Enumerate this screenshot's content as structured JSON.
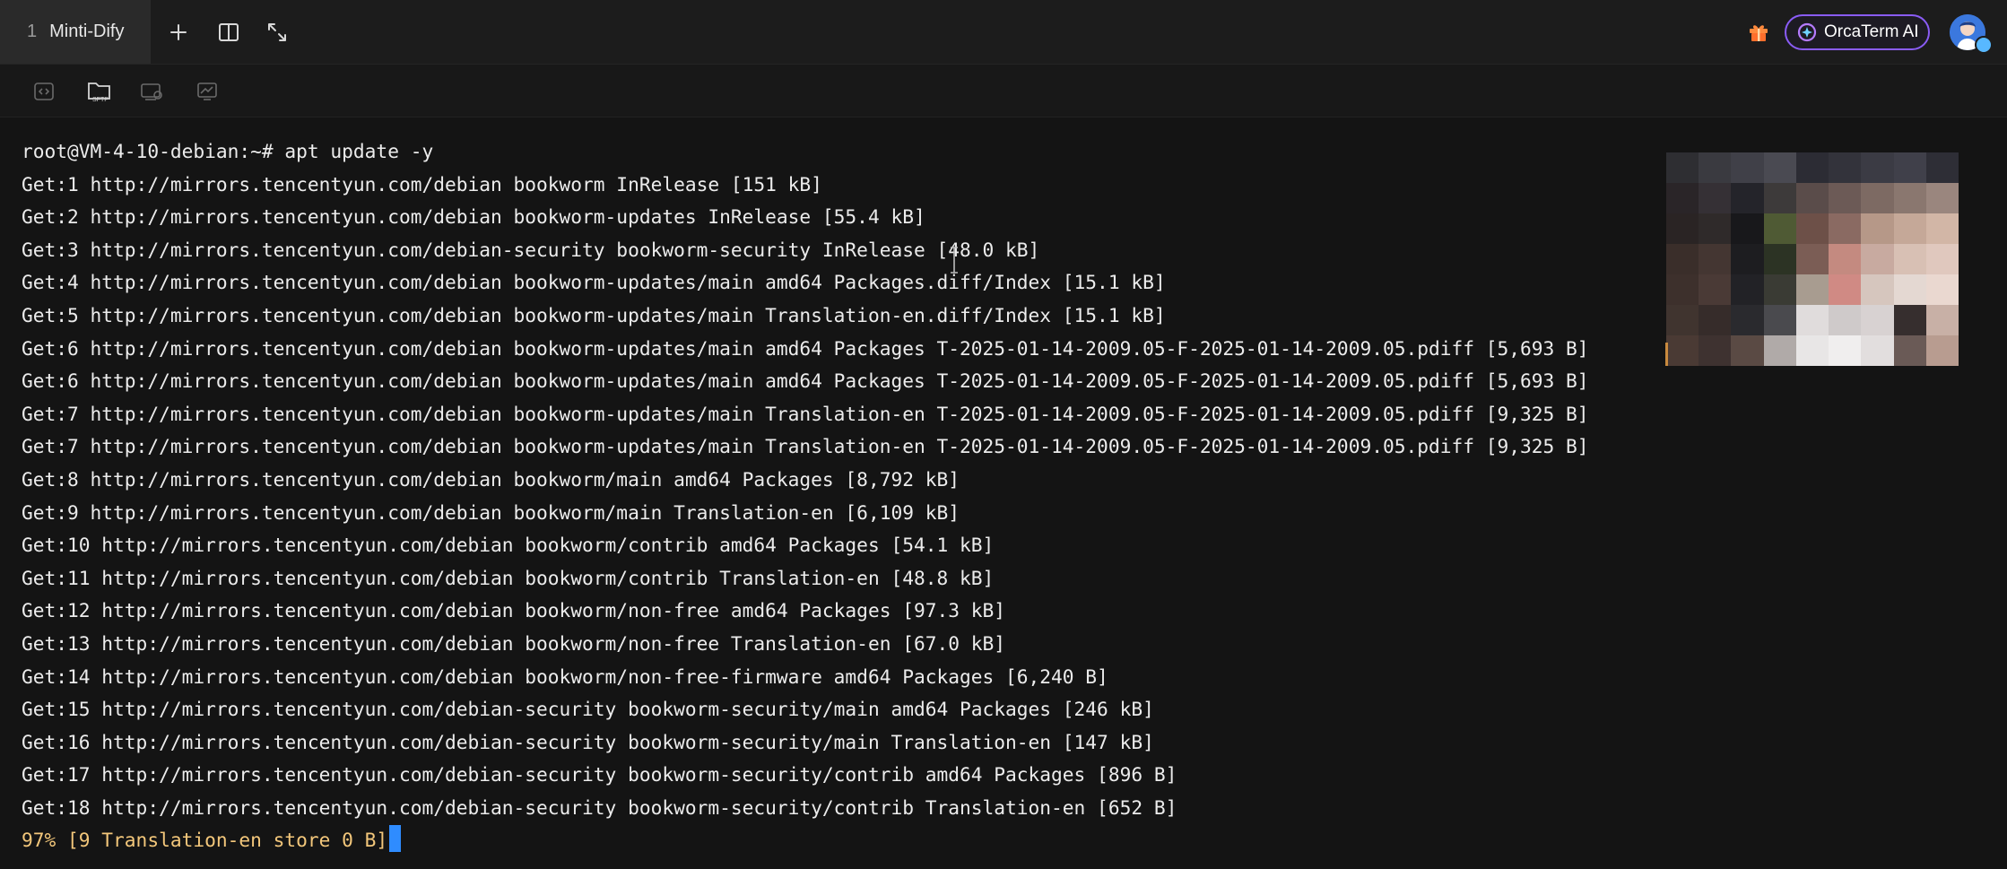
{
  "tab": {
    "index": "1",
    "title": "Minti-Dify"
  },
  "header": {
    "ai_button_label": "OrcaTerm AI",
    "icons": [
      "plus-icon",
      "split-view-icon",
      "expand-icon",
      "gift-icon",
      "orcaterm-logo-icon",
      "avatar"
    ]
  },
  "toolbar": {
    "sftp_label": "SFTP",
    "icons": [
      "code-icon",
      "sftp-folder-icon",
      "screen-record-icon",
      "monitor-chart-icon"
    ]
  },
  "colors": {
    "background": "#141414",
    "text": "#ececec",
    "progress_text": "#f3c77b",
    "cursor": "#2f8cff",
    "ai_border": "#8a5cf6"
  },
  "terminal": {
    "prompt": "root@VM-4-10-debian:~# apt update -y",
    "lines": [
      "Get:1 http://mirrors.tencentyun.com/debian bookworm InRelease [151 kB]",
      "Get:2 http://mirrors.tencentyun.com/debian bookworm-updates InRelease [55.4 kB]",
      "Get:3 http://mirrors.tencentyun.com/debian-security bookworm-security InRelease [48.0 kB]",
      "Get:4 http://mirrors.tencentyun.com/debian bookworm-updates/main amd64 Packages.diff/Index [15.1 kB]",
      "Get:5 http://mirrors.tencentyun.com/debian bookworm-updates/main Translation-en.diff/Index [15.1 kB]",
      "Get:6 http://mirrors.tencentyun.com/debian bookworm-updates/main amd64 Packages T-2025-01-14-2009.05-F-2025-01-14-2009.05.pdiff [5,693 B]",
      "Get:6 http://mirrors.tencentyun.com/debian bookworm-updates/main amd64 Packages T-2025-01-14-2009.05-F-2025-01-14-2009.05.pdiff [5,693 B]",
      "Get:7 http://mirrors.tencentyun.com/debian bookworm-updates/main Translation-en T-2025-01-14-2009.05-F-2025-01-14-2009.05.pdiff [9,325 B]",
      "Get:7 http://mirrors.tencentyun.com/debian bookworm-updates/main Translation-en T-2025-01-14-2009.05-F-2025-01-14-2009.05.pdiff [9,325 B]",
      "Get:8 http://mirrors.tencentyun.com/debian bookworm/main amd64 Packages [8,792 kB]",
      "Get:9 http://mirrors.tencentyun.com/debian bookworm/main Translation-en [6,109 kB]",
      "Get:10 http://mirrors.tencentyun.com/debian bookworm/contrib amd64 Packages [54.1 kB]",
      "Get:11 http://mirrors.tencentyun.com/debian bookworm/contrib Translation-en [48.8 kB]",
      "Get:12 http://mirrors.tencentyun.com/debian bookworm/non-free amd64 Packages [97.3 kB]",
      "Get:13 http://mirrors.tencentyun.com/debian bookworm/non-free Translation-en [67.0 kB]",
      "Get:14 http://mirrors.tencentyun.com/debian bookworm/non-free-firmware amd64 Packages [6,240 B]",
      "Get:15 http://mirrors.tencentyun.com/debian-security bookworm-security/main amd64 Packages [246 kB]",
      "Get:16 http://mirrors.tencentyun.com/debian-security bookworm-security/main Translation-en [147 kB]",
      "Get:17 http://mirrors.tencentyun.com/debian-security bookworm-security/contrib amd64 Packages [896 B]",
      "Get:18 http://mirrors.tencentyun.com/debian-security bookworm-security/contrib Translation-en [652 B]"
    ],
    "progress": "97% [9 Translation-en store 0 B]"
  }
}
